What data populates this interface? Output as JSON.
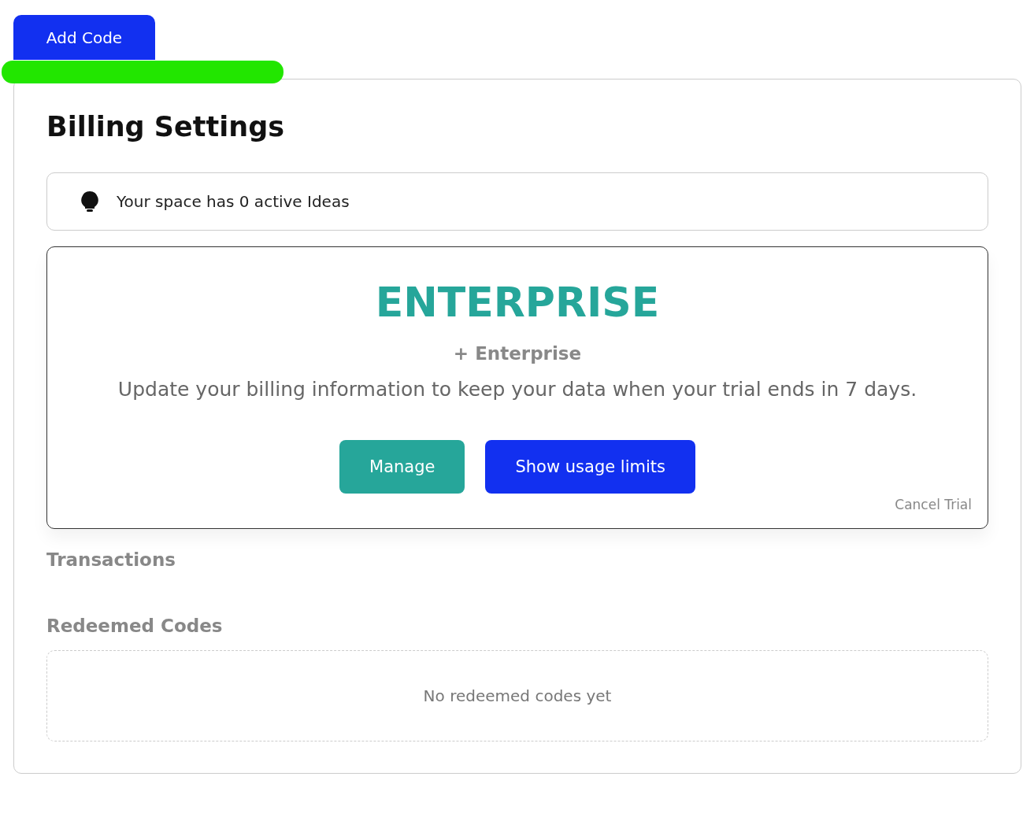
{
  "add_button": {
    "label": "Add Code"
  },
  "highlight": {
    "color": "#22e600"
  },
  "title": "Billing Settings",
  "info": {
    "text": "Your space has 0 active Ideas"
  },
  "plan": {
    "name": "ENTERPRISE",
    "addon": "+ Enterprise",
    "message": "Update your billing information to keep your data when your trial ends in 7 days.",
    "buttons": [
      {
        "label": "Manage",
        "kind": "teal"
      },
      {
        "label": "Show usage limits",
        "kind": "blue"
      }
    ],
    "cancel_link": "Cancel Trial"
  },
  "sections": [
    {
      "heading": "Transactions"
    },
    {
      "heading": "Redeemed Codes",
      "empty_text": "No redeemed codes yet"
    }
  ]
}
